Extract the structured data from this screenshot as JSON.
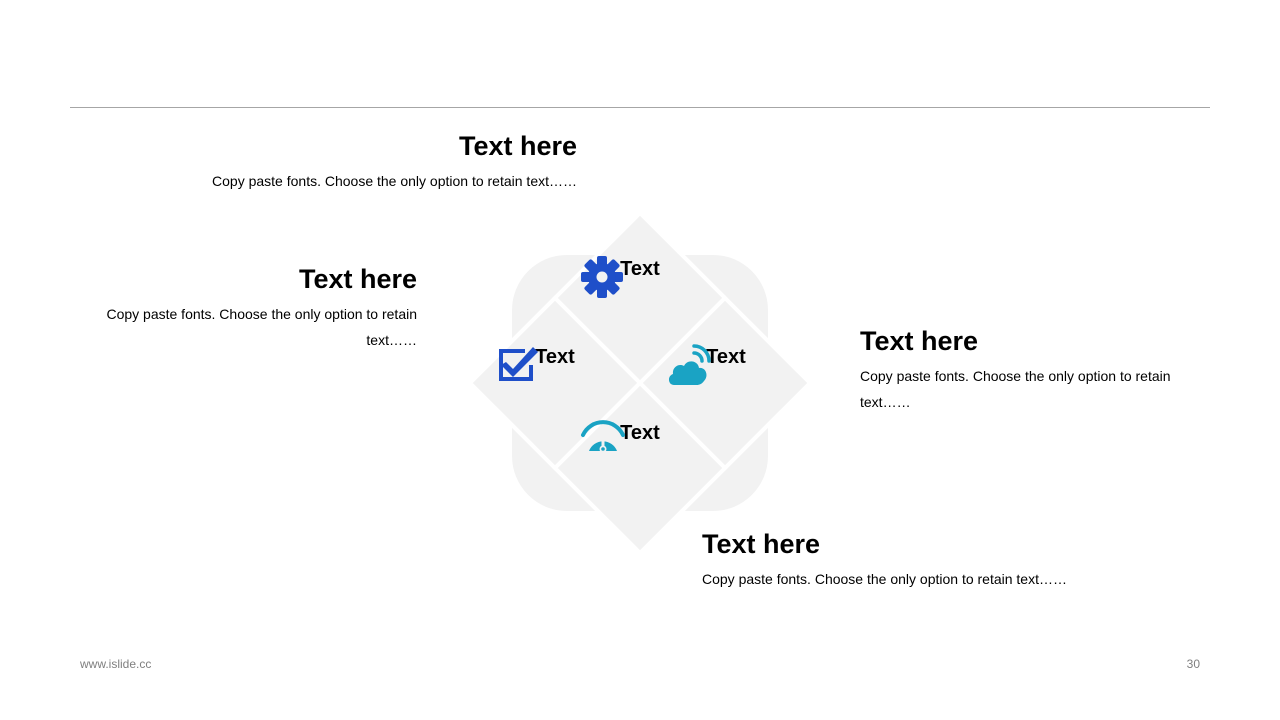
{
  "blocks": {
    "top": {
      "title": "Text here",
      "body": "Copy paste fonts. Choose the only option to retain text……"
    },
    "left": {
      "title": "Text here",
      "body": "Copy paste fonts. Choose the only option to retain text……"
    },
    "right": {
      "title": "Text here",
      "body": "Copy paste fonts. Choose the only option to retain text……"
    },
    "bottom": {
      "title": "Text here",
      "body": "Copy paste fonts. Choose the only option to retain text……"
    }
  },
  "diagram": {
    "cells": {
      "top": {
        "label": "Text",
        "icon": "gear-icon"
      },
      "left": {
        "label": "Text",
        "icon": "checkbox-icon"
      },
      "right": {
        "label": "Text",
        "icon": "cloud-signal-icon"
      },
      "bottom": {
        "label": "Text",
        "icon": "gauge-icon"
      }
    },
    "colors": {
      "tile": "#f2f2f2",
      "divider": "#ffffff",
      "blue": "#1f4fc9",
      "teal": "#1aa3c4"
    }
  },
  "footer": {
    "url": "www.islide.cc",
    "page": "30"
  }
}
